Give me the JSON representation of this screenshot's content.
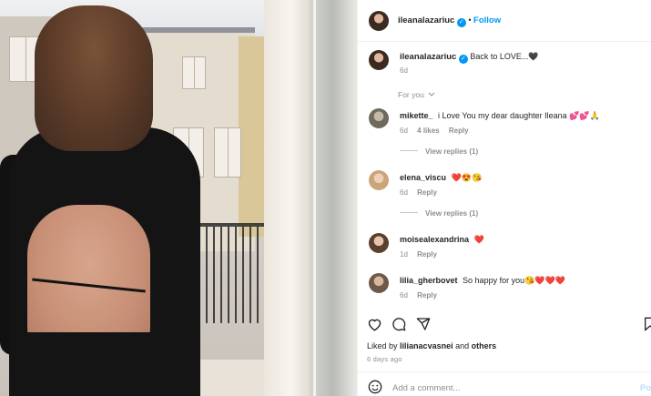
{
  "post": {
    "author": "ileanalazariuc",
    "follow_label": "Follow",
    "dot": "•",
    "caption": "Back to LOVE...🖤",
    "caption_time": "6d",
    "sort_label": "For you",
    "likes_prefix": "Liked by",
    "liked_by_user": "lilianacvasnei",
    "likes_and": "and",
    "likes_others": "others",
    "posted_ago": "6 days ago",
    "comment_placeholder": "Add a comment...",
    "post_label": "Po"
  },
  "comments": [
    {
      "user": "mikette_",
      "text": "i Love You my dear daughter Ileana 💕💕🙏",
      "time": "6d",
      "likes": "4 likes",
      "reply_label": "Reply",
      "view_replies": "View replies (1)"
    },
    {
      "user": "elena_viscu",
      "text": "❤️😍😘",
      "time": "6d",
      "reply_label": "Reply",
      "view_replies": "View replies (1)"
    },
    {
      "user": "moisealexandrina",
      "text": "❤️",
      "time": "1d",
      "reply_label": "Reply"
    },
    {
      "user": "lilia_gherbovet",
      "text": "So happy for you😘❤️❤️❤️",
      "time": "6d",
      "reply_label": "Reply"
    }
  ],
  "icons": {
    "like": "heart-icon",
    "comment": "comment-icon",
    "share": "share-icon",
    "save": "bookmark-icon",
    "emoji": "emoji-icon",
    "chevron": "chevron-down-icon",
    "verified": "verified-badge-icon"
  },
  "colors": {
    "accent": "#0095f6",
    "muted": "#8e8e8e",
    "text": "#262626"
  }
}
